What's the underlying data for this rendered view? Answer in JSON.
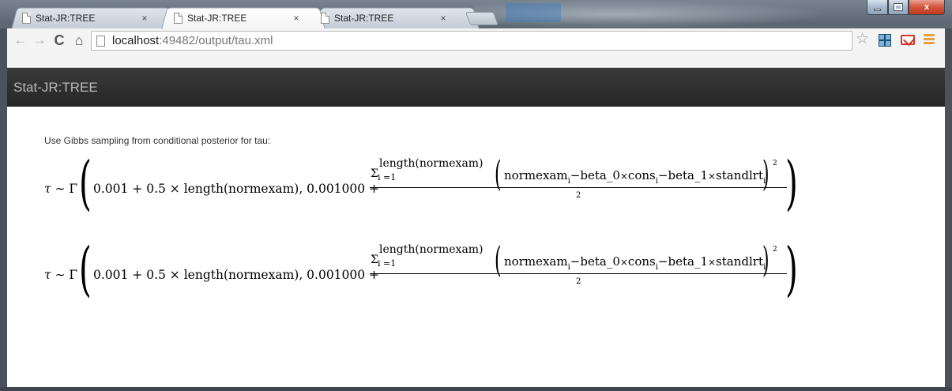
{
  "window": {
    "controls": {
      "minimize": "minimize",
      "maximize": "maximize",
      "close": "x"
    }
  },
  "tabs": [
    {
      "title": "Stat-JR:TREE",
      "close": "×",
      "active": false
    },
    {
      "title": "Stat-JR:TREE",
      "close": "×",
      "active": true
    },
    {
      "title": "Stat-JR:TREE",
      "close": "×",
      "active": false
    }
  ],
  "toolbar": {
    "back": "←",
    "forward": "→",
    "reload": "C",
    "home": "⌂",
    "url_host": "localhost",
    "url_path": ":49482/output/tau.xml",
    "star": "☆"
  },
  "app": {
    "brand": "Stat-JR:TREE"
  },
  "content": {
    "intro": "Use Gibbs sampling from conditional posterior for tau:",
    "equations": [
      {
        "lhs_symbol": "τ",
        "relation": " ∼ Γ",
        "args": "0.001 + 0.5 × length(normexam), 0.001000 +",
        "sigma": "Σ",
        "upper": "length(normexam)",
        "lower": "i =1",
        "num_a": "normexam",
        "num_sub": "i",
        "num_b": "−beta_0",
        "num_c": "×",
        "num_d": "cons",
        "num_e": "−beta_1",
        "num_f": "×",
        "num_g": "standlrt",
        "power": "2",
        "denominator": "2"
      },
      {
        "lhs_symbol": "τ",
        "relation": " ∼ Γ",
        "args": "0.001 + 0.5 × length(normexam), 0.001000 +",
        "sigma": "Σ",
        "upper": "length(normexam)",
        "lower": "i =1",
        "num_a": "normexam",
        "num_sub": "i",
        "num_b": "−beta_0",
        "num_c": "×",
        "num_d": "cons",
        "num_e": "−beta_1",
        "num_f": "×",
        "num_g": "standlrt",
        "power": "2",
        "denominator": "2"
      }
    ]
  }
}
